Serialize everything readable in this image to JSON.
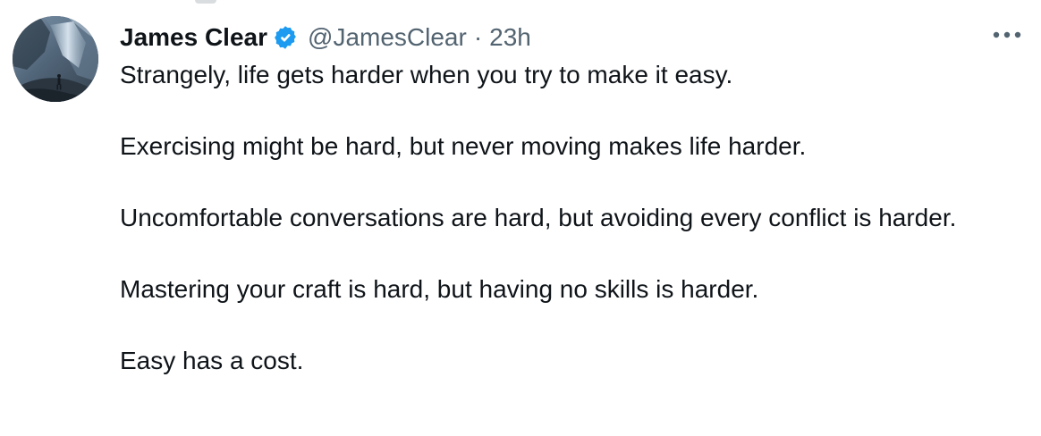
{
  "tweet": {
    "author_name": "James Clear",
    "handle": "@JamesClear",
    "separator": "·",
    "time": "23h",
    "paragraphs": [
      "Strangely, life gets harder when you try to make it easy.",
      "Exercising might be hard, but never moving makes life harder.",
      "Uncomfortable conversations are hard, but avoiding every conflict is harder.",
      "Mastering your craft is hard, but having no skills is harder.",
      "Easy has a cost."
    ]
  },
  "icons": {
    "verified": "verified-badge-icon",
    "more": "more-options-icon"
  },
  "colors": {
    "text": "#0f1419",
    "muted": "#536471",
    "verified": "#1d9bf0",
    "background": "#ffffff"
  }
}
